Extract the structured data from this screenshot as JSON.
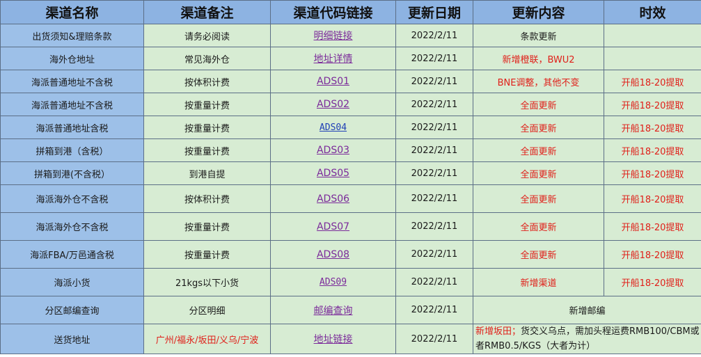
{
  "headers": [
    "渠道名称",
    "渠道备注",
    "渠道代码链接",
    "更新日期",
    "更新内容",
    "时效"
  ],
  "rows": [
    {
      "name": "出货须知&理赔条款",
      "note": "请务必阅读",
      "link": "明细链接",
      "date": "2022/2/11",
      "content": "条款更新",
      "time": ""
    },
    {
      "name": "海外仓地址",
      "note": "常见海外仓",
      "link": "地址详情",
      "date": "2022/2/11",
      "content": "新增橙联，BWU2",
      "time": ""
    },
    {
      "name": "海派普通地址不含税",
      "note": "按体积计费",
      "link": "ADS01",
      "date": "2022/2/11",
      "content": "BNE调整，其他不变",
      "time": "开船18-20提取"
    },
    {
      "name": "海派普通地址不含税",
      "note": "按重量计费",
      "link": "ADS02",
      "date": "2022/2/11",
      "content": "全面更新",
      "time": "开船18-20提取"
    },
    {
      "name": "海派普通地址含税",
      "note": "按重量计费",
      "link": "ADS04",
      "date": "2022/2/11",
      "content": "全面更新",
      "time": "开船18-20提取"
    },
    {
      "name": "拼箱到港（含税）",
      "note": "按重量计费",
      "link": "ADS03",
      "date": "2022/2/11",
      "content": "全面更新",
      "time": "开船18-20提取"
    },
    {
      "name": "拼箱到港(不含税）",
      "note": "到港自提",
      "link": "ADS05",
      "date": "2022/2/11",
      "content": "全面更新",
      "time": "开船18-20提取"
    },
    {
      "name": "海派海外仓不含税",
      "note": "按体积计费",
      "link": "ADS06",
      "date": "2022/2/11",
      "content": "全面更新",
      "time": "开船18-20提取"
    },
    {
      "name": "海派海外仓不含税",
      "note": "按重量计费",
      "link": "ADS07",
      "date": "2022/2/11",
      "content": "全面更新",
      "time": "开船18-20提取"
    },
    {
      "name": "海派FBA/万邑通含税",
      "note": "按重量计费",
      "link": "ADS08",
      "date": "2022/2/11",
      "content": "全面更新",
      "time": "开船18-20提取"
    },
    {
      "name": "海派小货",
      "note": "21kgs以下小货",
      "link": "ADS09",
      "date": "2022/2/11",
      "content": "新增渠道",
      "time": "开船18-20提取"
    },
    {
      "name": "分区邮编查询",
      "note": "分区明细",
      "link": "邮编查询",
      "date": "2022/2/11",
      "content": "新增邮编",
      "time": ""
    },
    {
      "name": "送货地址",
      "note": "广州/福永/坂田/义乌/宁波",
      "link": "地址链接",
      "date": "2022/2/11",
      "content": "新增坂田；货交义乌点，需加头程运费RMB100/CBM或者RMB0.5/KGS（大者为计）",
      "time": ""
    }
  ],
  "colors": {
    "header_bg": "#8db3e2",
    "name_bg": "#9dc0e8",
    "cell_bg": "#d7ecd3",
    "red": "#e0201a",
    "link_purple": "#7b2a9a",
    "link_blue": "#1f3fb6"
  }
}
